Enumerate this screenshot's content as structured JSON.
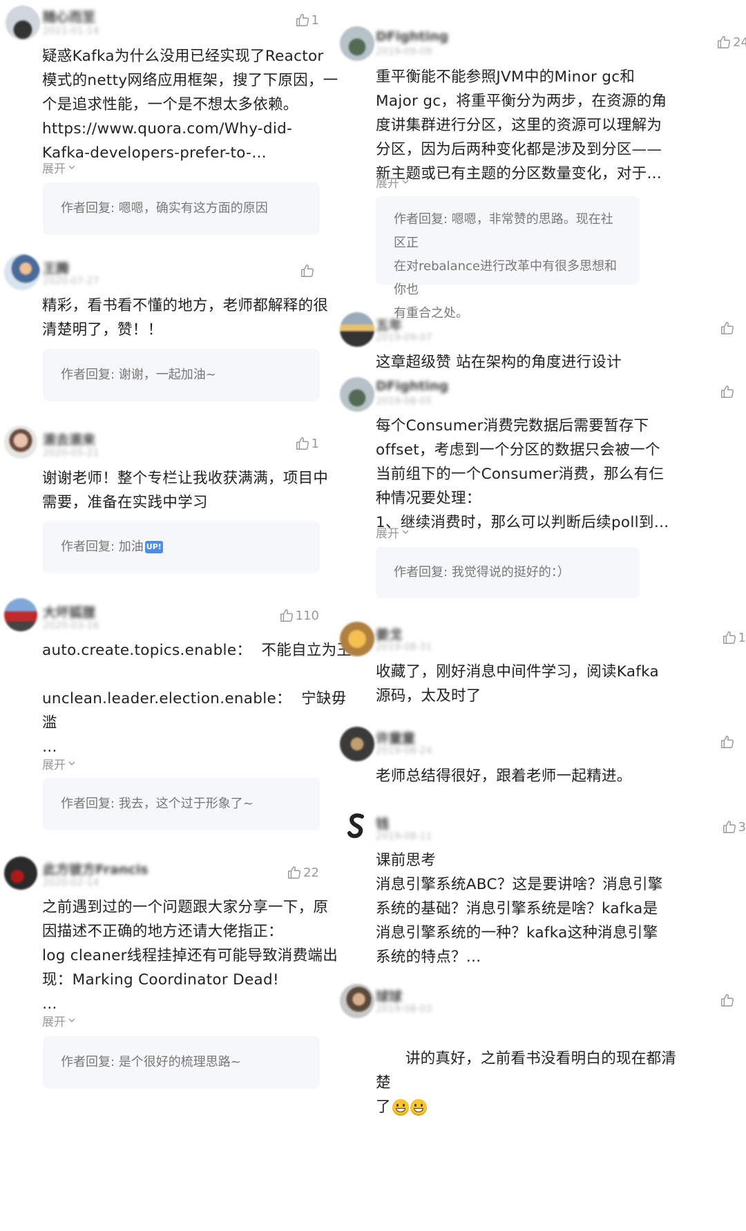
{
  "left": {
    "comments": [
      {
        "name": "随心而至",
        "date": "2021-01-14",
        "likes": "1",
        "text": "疑惑Kafka为什么没用已经实现了Reactor\n模式的netty网络应用框架，搜了下原因，一\n个是追求性能，一个是不想太多依赖。\nhttps://www.quora.com/Why-did-\nKafka-developers-prefer-to-…",
        "expand": "展开",
        "reply": "作者回复: 嗯嗯，确实有这方面的原因"
      },
      {
        "name": "王腾",
        "date": "2020-07-27",
        "likes": "",
        "text": "精彩，看书看不懂的地方，老师都解释的很\n清楚明了，赞！！",
        "reply": "作者回复: 谢谢，一起加油~"
      },
      {
        "name": "滚去滚来",
        "date": "2020-05-21",
        "likes": "1",
        "text": "谢谢老师！整个专栏让我收获满满，项目中\n需要，准备在实践中学习",
        "reply": "作者回复: 加油",
        "reply_emoji": "UP!"
      },
      {
        "name": "大坏狐狸",
        "date": "2020-03-16",
        "likes": "110",
        "text": "auto.create.topics.enable：  不能自立为王\n\nunclean.leader.election.enable：  宁缺毋\n滥\n…",
        "expand": "展开",
        "reply": "作者回复: 我去，这个过于形象了~"
      },
      {
        "name": "此方彼方Francis",
        "date": "2020-02-14",
        "likes": "22",
        "text": "之前遇到过的一个问题跟大家分享一下，原\n因描述不正确的地方还请大佬指正：\nlog cleaner线程挂掉还有可能导致消费端出\n现：Marking Coordinator Dead!\n…",
        "expand": "展开",
        "reply": "作者回复: 是个很好的梳理思路~"
      }
    ]
  },
  "right": {
    "comments": [
      {
        "name": "DFighting",
        "date": "2019-09-09",
        "likes": "24",
        "text": "重平衡能不能参照JVM中的Minor gc和\nMajor gc，将重平衡分为两步，在资源的角\n度讲集群进行分区，这里的资源可以理解为\n分区，因为后两种变化都是涉及到分区——\n新主题或已有主题的分区数量变化，对于…",
        "expand": "展开",
        "reply": "作者回复: 嗯嗯，非常赞的思路。现在社区正\n在对rebalance进行改革中有很多思想和你也\n有重合之处。"
      },
      {
        "name": "五年",
        "date": "2019-09-07",
        "likes": "",
        "text": "这章超级赞 站在架构的角度进行设计"
      },
      {
        "name": "DFighting",
        "date": "2019-08-05",
        "likes": "",
        "text": "每个Consumer消费完数据后需要暂存下\noffset，考虑到一个分区的数据只会被一个\n当前组下的一个Consumer消费，那么有仨\n种情况要处理：\n1、继续消费时，那么可以判断后续poll到…",
        "expand": "展开",
        "reply": "作者回复: 我觉得说的挺好的：）"
      },
      {
        "name": "姜戈",
        "date": "2019-08-31",
        "likes": "1",
        "text": "收藏了，刚好消息中间件学习，阅读Kafka\n源码，太及时了"
      },
      {
        "name": "许童童",
        "date": "2019-08-24",
        "likes": "",
        "text": "老师总结得很好，跟着老师一起精进。"
      },
      {
        "name": "钱",
        "date": "2019-08-11",
        "likes": "3",
        "text": "课前思考\n消息引擎系统ABC？这是要讲啥？消息引擎\n系统的基础？消息引擎系统是啥？kafka是\n消息引擎系统的一种？kafka这种消息引擎\n系统的特点？…"
      },
      {
        "name": "球球",
        "date": "2019-08-03",
        "likes": "",
        "text": "讲的真好，之前看书没看明白的现在都清楚\n了"
      }
    ]
  }
}
